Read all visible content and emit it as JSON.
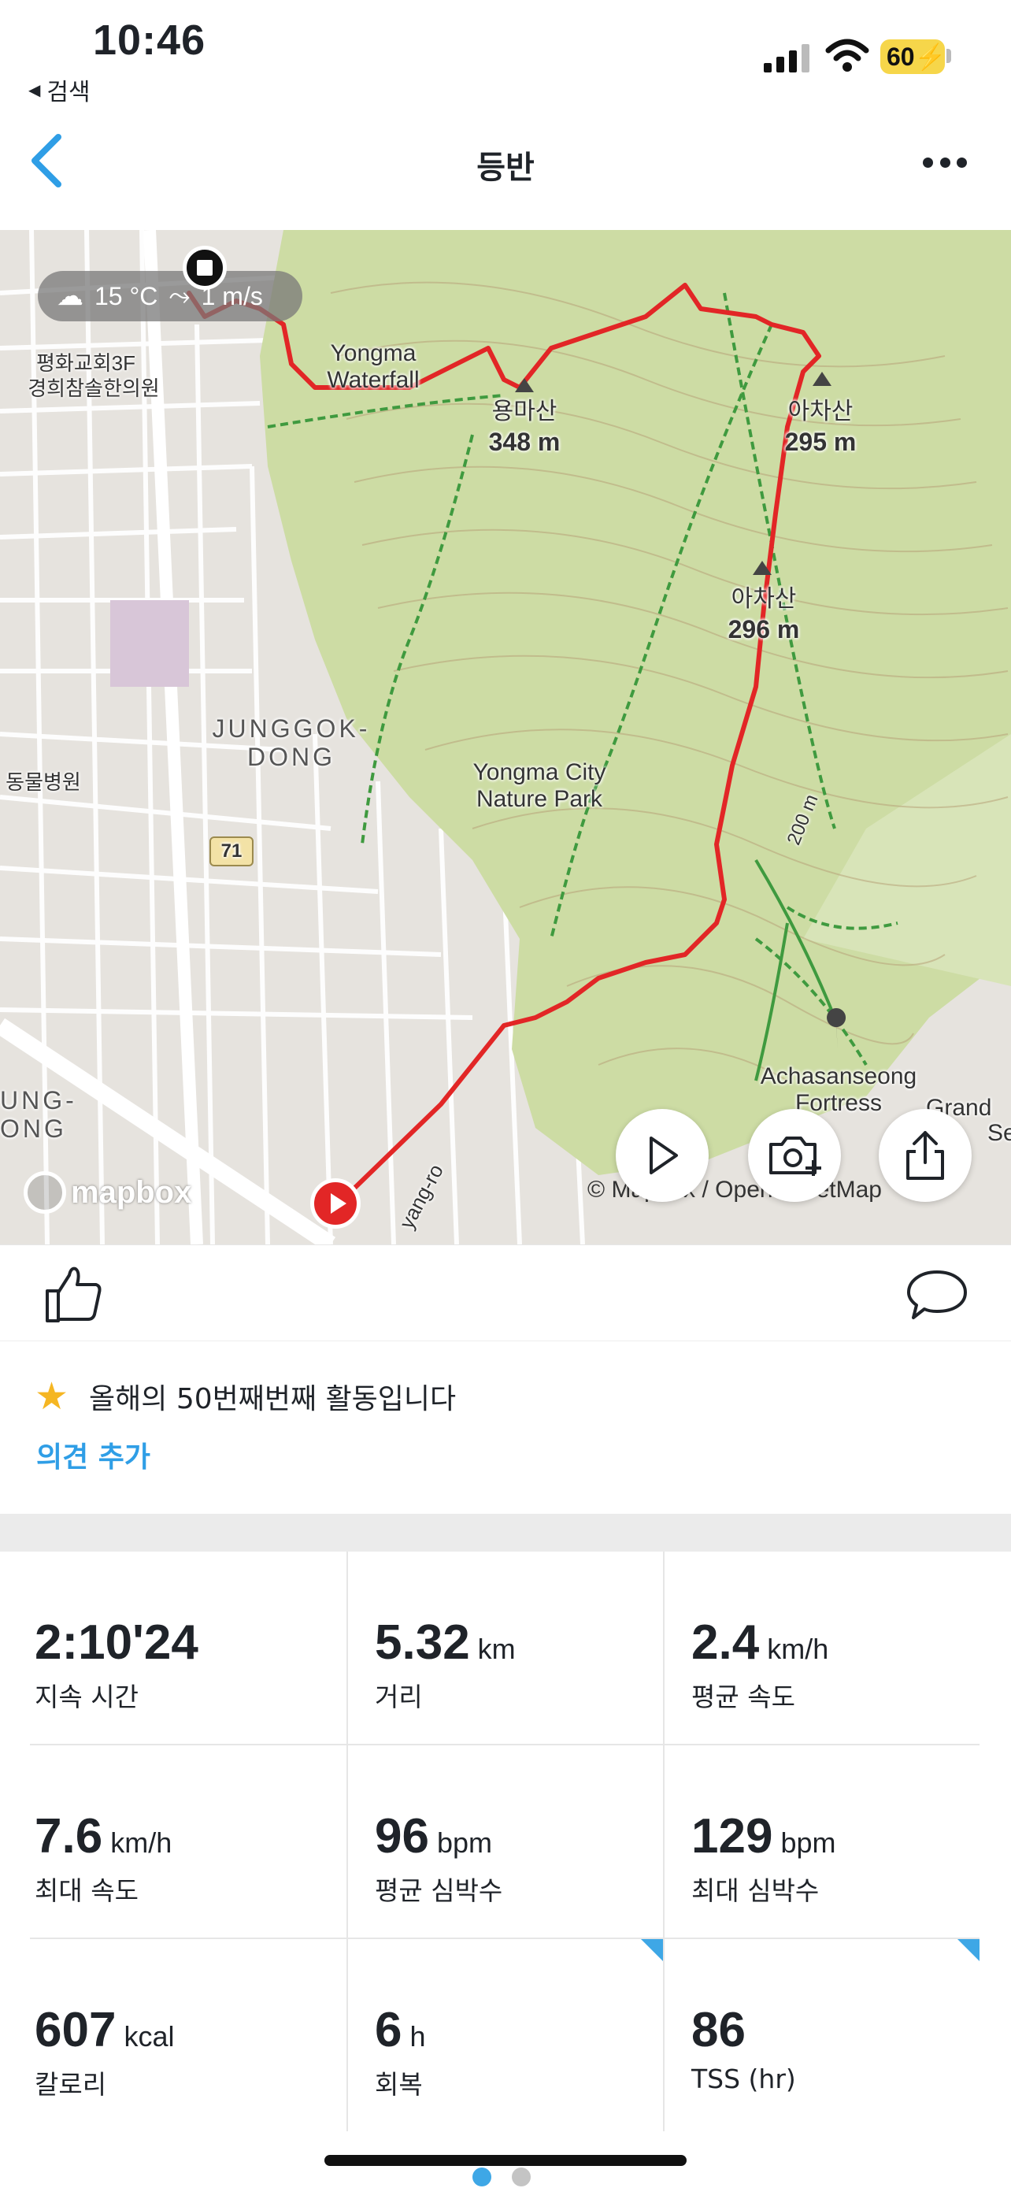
{
  "status": {
    "time": "10:46",
    "back_app_label": "검색",
    "battery": "60"
  },
  "nav": {
    "title": "등반"
  },
  "map": {
    "weather": "15 °C",
    "wind": "1 m/s",
    "labels": {
      "waterfall": "Yongma Waterfall",
      "peak1_name": "용마산",
      "peak1_elev": "348 m",
      "peak2_name": "아차산",
      "peak2_elev": "295 m",
      "peak3_name": "아차산",
      "peak3_elev": "296 m",
      "church": "평화교회3F",
      "clinic": "경희참솔한의원",
      "district": "JUNGGOK-",
      "district2": "DONG",
      "park": "Yongma City Nature Park",
      "hospital": "동물병원",
      "route_badge": "71",
      "contour": "200 m",
      "fortress": "Achasanseong Fortress",
      "road": "yang-ro",
      "left_district": "UNG-",
      "left_district2": "ONG",
      "grand": "Grand W",
      "grand2": "Se"
    },
    "logo": "mapbox",
    "attribution": "© Mapbox / OpenStreetMap",
    "colors": {
      "route": "#e22626",
      "park": "#c9dba0",
      "trail": "#3f9a3f"
    }
  },
  "achievement": {
    "text": "올해의 50번째번째 활동입니다",
    "add_comment": "의견 추가"
  },
  "stats": [
    {
      "value": "2:10'24",
      "unit": "",
      "label": "지속 시간"
    },
    {
      "value": "5.32",
      "unit": "km",
      "label": "거리"
    },
    {
      "value": "2.4",
      "unit": "km/h",
      "label": "평균 속도"
    },
    {
      "value": "7.6",
      "unit": "km/h",
      "label": "최대 속도"
    },
    {
      "value": "96",
      "unit": "bpm",
      "label": "평균 심박수"
    },
    {
      "value": "129",
      "unit": "bpm",
      "label": "최대 심박수"
    },
    {
      "value": "607",
      "unit": "kcal",
      "label": "칼로리"
    },
    {
      "value": "6",
      "unit": "h",
      "label": "회복"
    },
    {
      "value": "86",
      "unit": "",
      "label": "TSS (hr)"
    }
  ],
  "icons": {
    "back": "chevron-left-icon",
    "more": "ellipsis-icon",
    "like": "thumbs-up-icon",
    "comment": "comment-bubble-icon",
    "play": "play-icon",
    "camera": "camera-add-icon",
    "share": "share-icon",
    "star": "star-icon"
  },
  "accent_color": "#2f9ee6"
}
